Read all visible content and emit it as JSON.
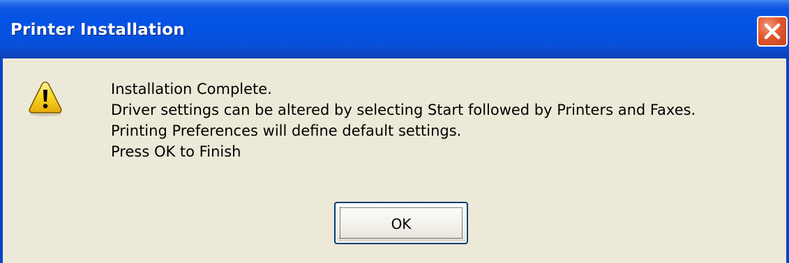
{
  "window": {
    "title": "Printer Installation",
    "close_icon": "close-icon"
  },
  "content": {
    "icon": "warning-icon",
    "lines": [
      "Installation Complete.",
      "Driver settings can be altered by selecting Start followed by Printers and Faxes.",
      "Printing Preferences will define default settings.",
      "Press OK to Finish"
    ]
  },
  "buttons": {
    "ok_label": "OK"
  },
  "colors": {
    "titlebar": "#0553E5",
    "background": "#ECE9D8",
    "close_button": "#E2582F",
    "warning_yellow": "#F7D51C"
  }
}
